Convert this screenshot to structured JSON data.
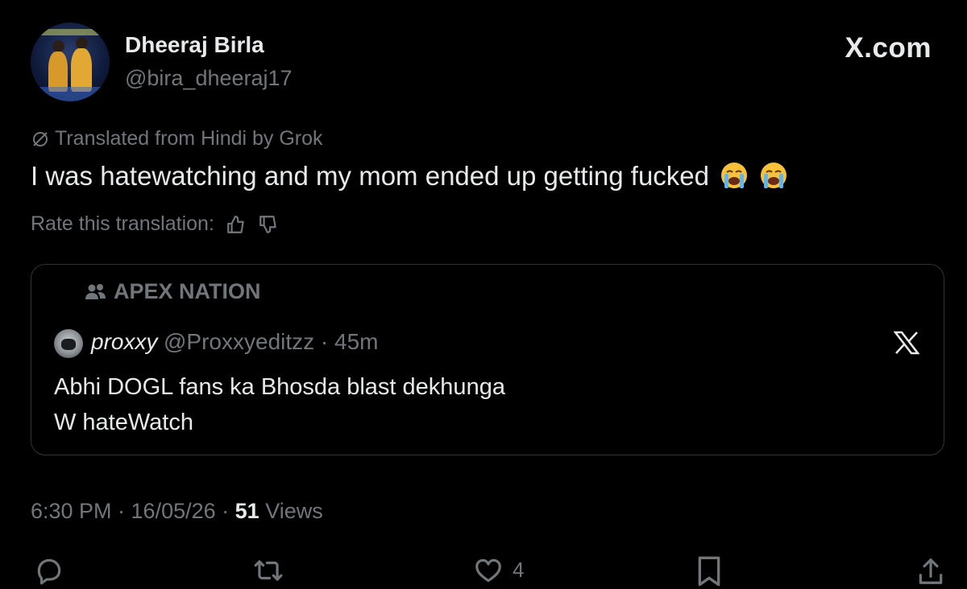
{
  "author": {
    "display_name": "Dheeraj Birla",
    "handle": "@bira_dheeraj17"
  },
  "brand": "X.com",
  "translation": {
    "notice": "Translated from Hindi by Grok",
    "rate_label": "Rate this translation:"
  },
  "post": {
    "text": "I was hatewatching and my mom ended up getting fucked",
    "emoji": [
      "loudly-crying-face",
      "loudly-crying-face"
    ]
  },
  "quote": {
    "community": "APEX NATION",
    "author_name": "proxxy",
    "meta": "@Proxxyeditzz · 45m",
    "line1": "Abhi DOGL fans ka Bhosda blast dekhunga",
    "line2": "W hateWatch"
  },
  "meta": {
    "time_date": "6:30 PM · 16/05/26 · ",
    "views_count": "51",
    "views_label": " Views"
  },
  "actions": {
    "likes": "4"
  },
  "colors": {
    "background": "#000000",
    "text": "#e7e9ea",
    "muted": "#71767b",
    "border": "#2f3336"
  }
}
